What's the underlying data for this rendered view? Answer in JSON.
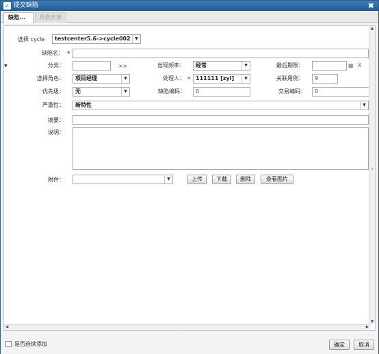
{
  "window": {
    "title": "提交缺陷",
    "close": "✖"
  },
  "tabs": [
    {
      "label": "缺陷..."
    },
    {
      "label": "用例步骤"
    }
  ],
  "form": {
    "cycle_label": "选择 cycle",
    "cycle_value": "testcenter5.6->cycle002",
    "defect_name_label": "缺陷名：",
    "category_label": "分类：",
    "category_more": ">>",
    "frequency_label": "出现频率：",
    "frequency_value": "经常",
    "deadline_label": "最后期限：",
    "deadline_clear": "X",
    "role_label": "选择角色：",
    "role_value": "项目经理",
    "handler_label": "处理人：",
    "handler_value": "111111 [zyl]",
    "linked_case_label": "关联用例：",
    "linked_case_value": "9",
    "priority_label": "优先级：",
    "priority_value": "无",
    "defect_code_label": "缺陷编码：",
    "defect_code_value": "0",
    "trade_code_label": "交易编码：",
    "trade_code_value": "0",
    "severity_label": "严重性：",
    "severity_value": "新特性",
    "summary_label": "摘要：",
    "description_label": "说明：",
    "attachment_label": "附件：",
    "upload_button": "上传",
    "download_button": "下载",
    "delete_button": "删除",
    "view_image_button": "查看图片"
  },
  "footer": {
    "continuous_add_label": "是否连续添加",
    "ok_button": "确定",
    "cancel_button": "取消"
  }
}
